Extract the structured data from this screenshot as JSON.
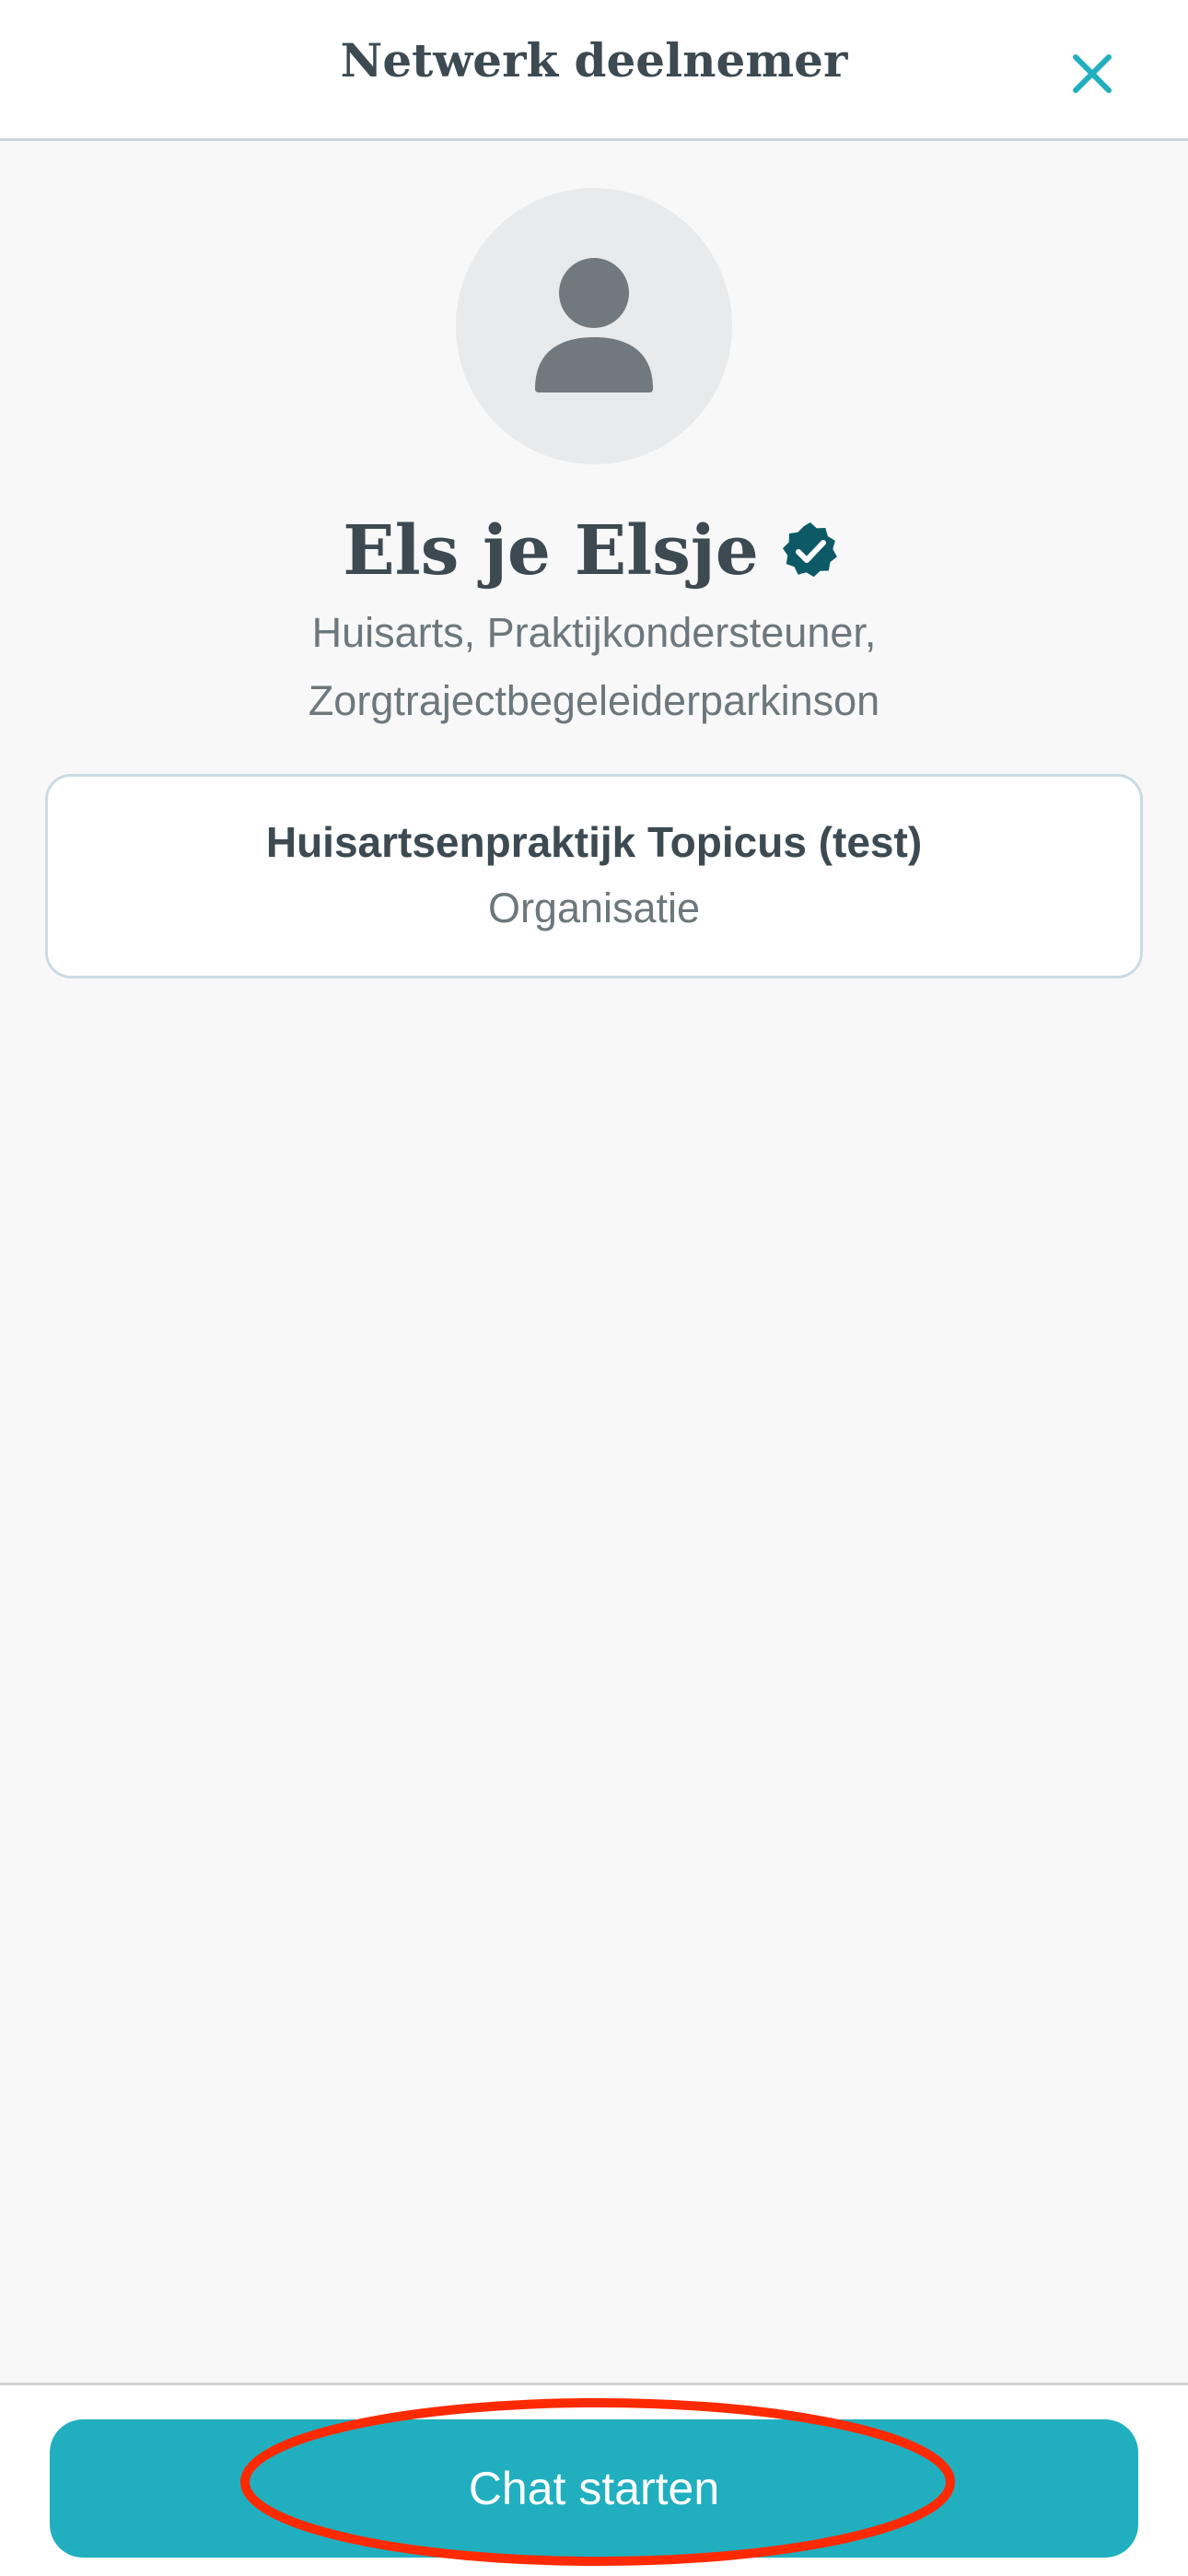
{
  "header": {
    "title": "Netwerk deelnemer",
    "close_icon": "close-icon"
  },
  "profile": {
    "avatar_icon": "person-icon",
    "name": "Els je Elsje",
    "verified_icon": "verified-badge-icon",
    "roles_line1": "Huisarts, Praktijkondersteuner,",
    "roles_line2": "Zorgtrajectbegeleiderparkinson"
  },
  "organization": {
    "name": "Huisartsenpraktijk Topicus (test)",
    "type": "Organisatie"
  },
  "footer": {
    "chat_button_label": "Chat starten"
  },
  "colors": {
    "accent": "#21afbf",
    "verified": "#0d5a66",
    "highlight": "#ff2a00",
    "text_dark": "#3d4a52",
    "text_muted": "#6d777c"
  }
}
